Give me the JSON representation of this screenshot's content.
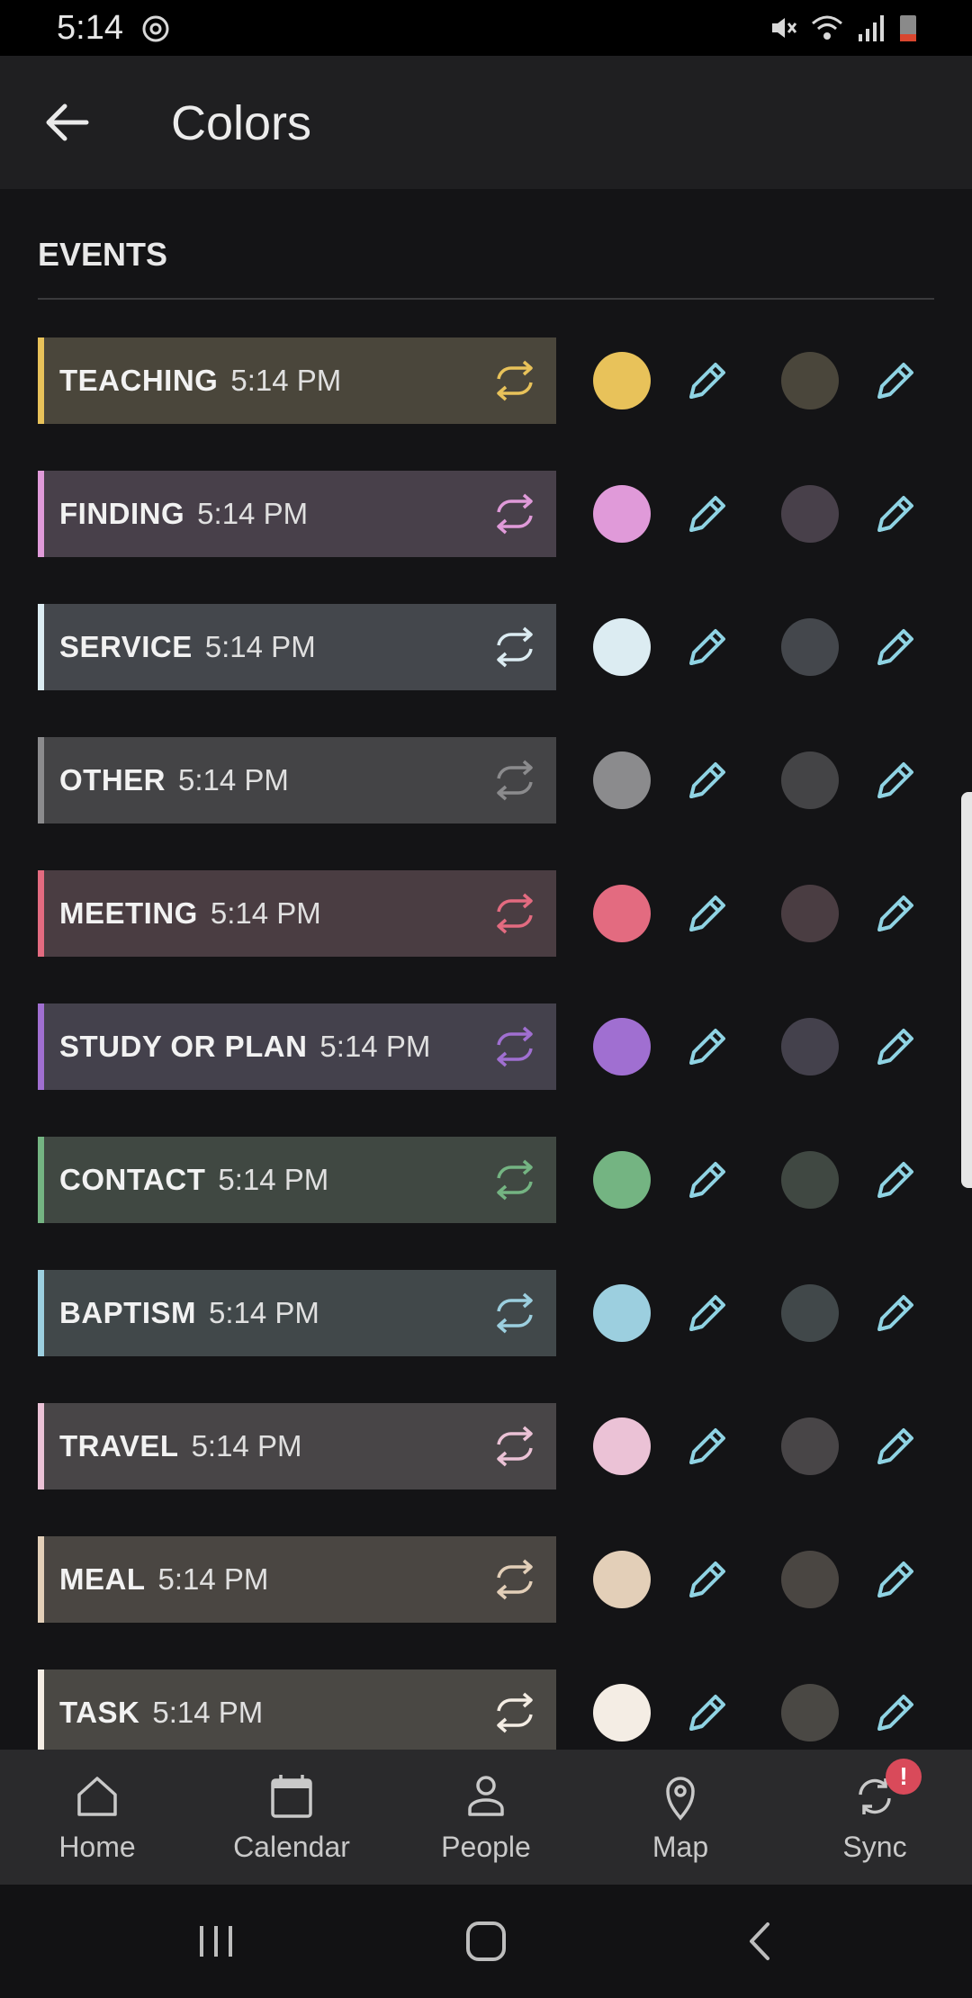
{
  "status": {
    "time": "5:14"
  },
  "appbar": {
    "title": "Colors"
  },
  "section": {
    "label": "EVENTS"
  },
  "events": [
    {
      "name": "TEACHING",
      "time": "5:14 PM",
      "color": "#e8c25a",
      "bg": "#4a463b",
      "dark": "#4a463b"
    },
    {
      "name": "FINDING",
      "time": "5:14 PM",
      "color": "#e09ad9",
      "bg": "#48404a",
      "dark": "#48404a"
    },
    {
      "name": "SERVICE",
      "time": "5:14 PM",
      "color": "#dcecf2",
      "bg": "#44474c",
      "dark": "#44474c"
    },
    {
      "name": "OTHER",
      "time": "5:14 PM",
      "color": "#8b8b8d",
      "bg": "#444446",
      "dark": "#444446"
    },
    {
      "name": "MEETING",
      "time": "5:14 PM",
      "color": "#e36b80",
      "bg": "#4a3d42",
      "dark": "#4a3d42"
    },
    {
      "name": "STUDY OR PLAN",
      "time": "5:14 PM",
      "color": "#a06fd1",
      "bg": "#44414c",
      "dark": "#44414c"
    },
    {
      "name": "CONTACT",
      "time": "5:14 PM",
      "color": "#74b482",
      "bg": "#404842",
      "dark": "#404842"
    },
    {
      "name": "BAPTISM",
      "time": "5:14 PM",
      "color": "#9ccfdf",
      "bg": "#41484a",
      "dark": "#41484a"
    },
    {
      "name": "TRAVEL",
      "time": "5:14 PM",
      "color": "#ebc2d6",
      "bg": "#484547",
      "dark": "#484547"
    },
    {
      "name": "MEAL",
      "time": "5:14 PM",
      "color": "#e3cfb8",
      "bg": "#4a4642",
      "dark": "#4a4642"
    },
    {
      "name": "TASK",
      "time": "5:14 PM",
      "color": "#f4ede4",
      "bg": "#4a4844",
      "dark": "#4a4844"
    }
  ],
  "bottom_nav": [
    {
      "label": "Home",
      "icon": "home-icon"
    },
    {
      "label": "Calendar",
      "icon": "calendar-icon"
    },
    {
      "label": "People",
      "icon": "person-icon"
    },
    {
      "label": "Map",
      "icon": "map-pin-icon"
    },
    {
      "label": "Sync",
      "icon": "sync-icon",
      "badge": "!"
    }
  ],
  "accent": "#8fd3e3"
}
